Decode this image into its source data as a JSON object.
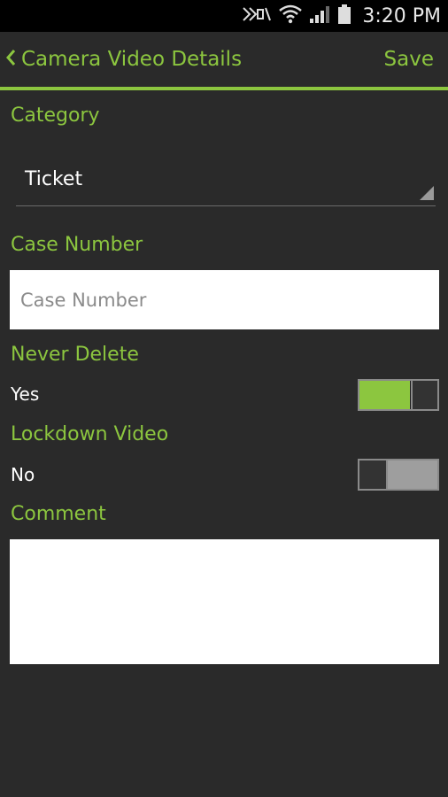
{
  "status_bar": {
    "time": "3:20 PM",
    "icons": [
      "nfc-icon",
      "wifi-icon",
      "signal-icon",
      "battery-icon"
    ]
  },
  "action_bar": {
    "back_icon": "chevron-left-icon",
    "title": "Camera Video Details",
    "save_label": "Save"
  },
  "form": {
    "category": {
      "label": "Category",
      "selected": "Ticket"
    },
    "case_number": {
      "label": "Case Number",
      "value": "",
      "placeholder": "Case Number"
    },
    "never_delete": {
      "label": "Never Delete",
      "value_text": "Yes",
      "on": true
    },
    "lockdown_video": {
      "label": "Lockdown Video",
      "value_text": "No",
      "on": false
    },
    "comment": {
      "label": "Comment",
      "value": ""
    }
  },
  "colors": {
    "accent": "#8cc63f",
    "background": "#2a2a2a",
    "status_bar": "#000000",
    "input_background": "#ffffff"
  }
}
